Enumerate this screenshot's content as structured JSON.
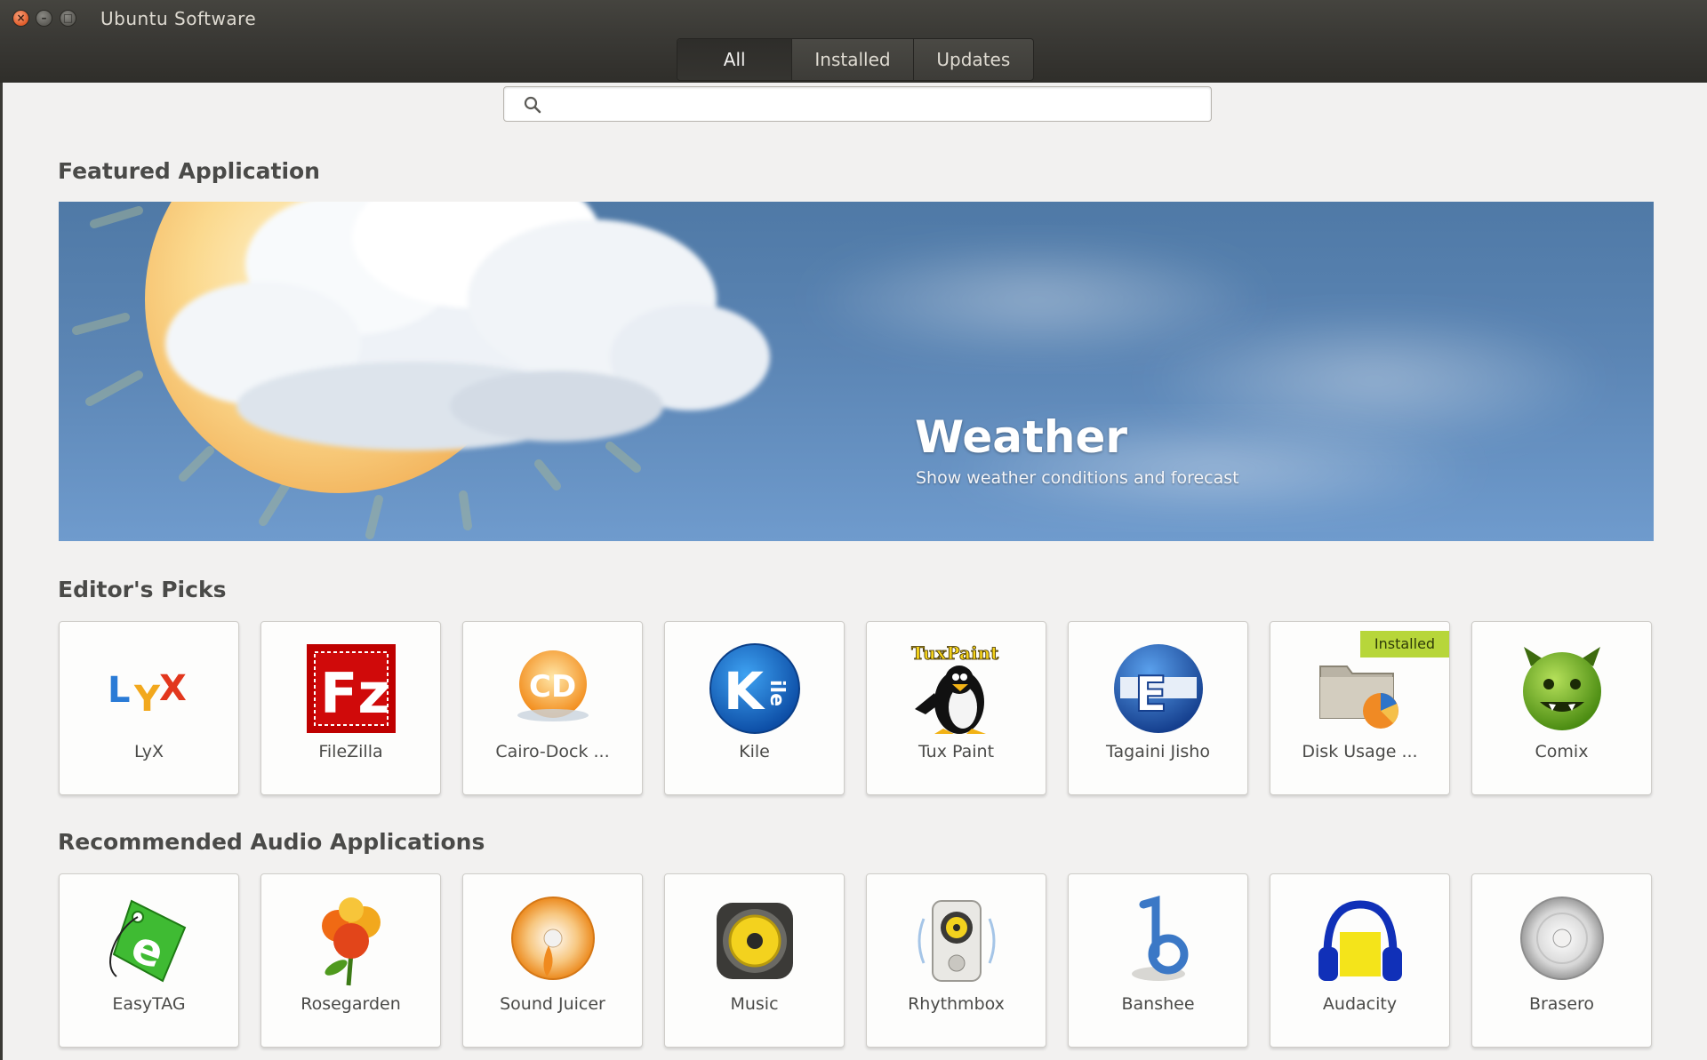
{
  "window": {
    "title": "Ubuntu Software"
  },
  "tabs": [
    {
      "label": "All",
      "active": true
    },
    {
      "label": "Installed",
      "active": false
    },
    {
      "label": "Updates",
      "active": false
    }
  ],
  "search": {
    "value": "",
    "placeholder": ""
  },
  "featured": {
    "section_title": "Featured Application",
    "app_name": "Weather",
    "description": "Show weather conditions and forecast"
  },
  "editors_picks": {
    "section_title": "Editor's Picks",
    "apps": [
      {
        "name": "LyX",
        "icon": "lyx-icon"
      },
      {
        "name": "FileZilla",
        "icon": "filezilla-icon"
      },
      {
        "name": "Cairo-Dock ...",
        "icon": "cairo-dock-icon"
      },
      {
        "name": "Kile",
        "icon": "kile-icon"
      },
      {
        "name": "Tux Paint",
        "icon": "tux-paint-icon"
      },
      {
        "name": "Tagaini Jisho",
        "icon": "tagaini-jisho-icon"
      },
      {
        "name": "Disk Usage ...",
        "icon": "disk-usage-icon",
        "badge": "Installed"
      },
      {
        "name": "Comix",
        "icon": "comix-icon"
      }
    ]
  },
  "audio": {
    "section_title": "Recommended Audio Applications",
    "apps": [
      {
        "name": "EasyTAG",
        "icon": "easytag-icon"
      },
      {
        "name": "Rosegarden",
        "icon": "rosegarden-icon"
      },
      {
        "name": "Sound Juicer",
        "icon": "sound-juicer-icon"
      },
      {
        "name": "Music",
        "icon": "music-icon"
      },
      {
        "name": "Rhythmbox",
        "icon": "rhythmbox-icon"
      },
      {
        "name": "Banshee",
        "icon": "banshee-icon"
      },
      {
        "name": "Audacity",
        "icon": "audacity-icon"
      },
      {
        "name": "Brasero",
        "icon": "brasero-icon"
      }
    ]
  },
  "colors": {
    "accent": "#e05c2a",
    "installed_badge": "#b7d63a",
    "header": "#3a3935"
  }
}
